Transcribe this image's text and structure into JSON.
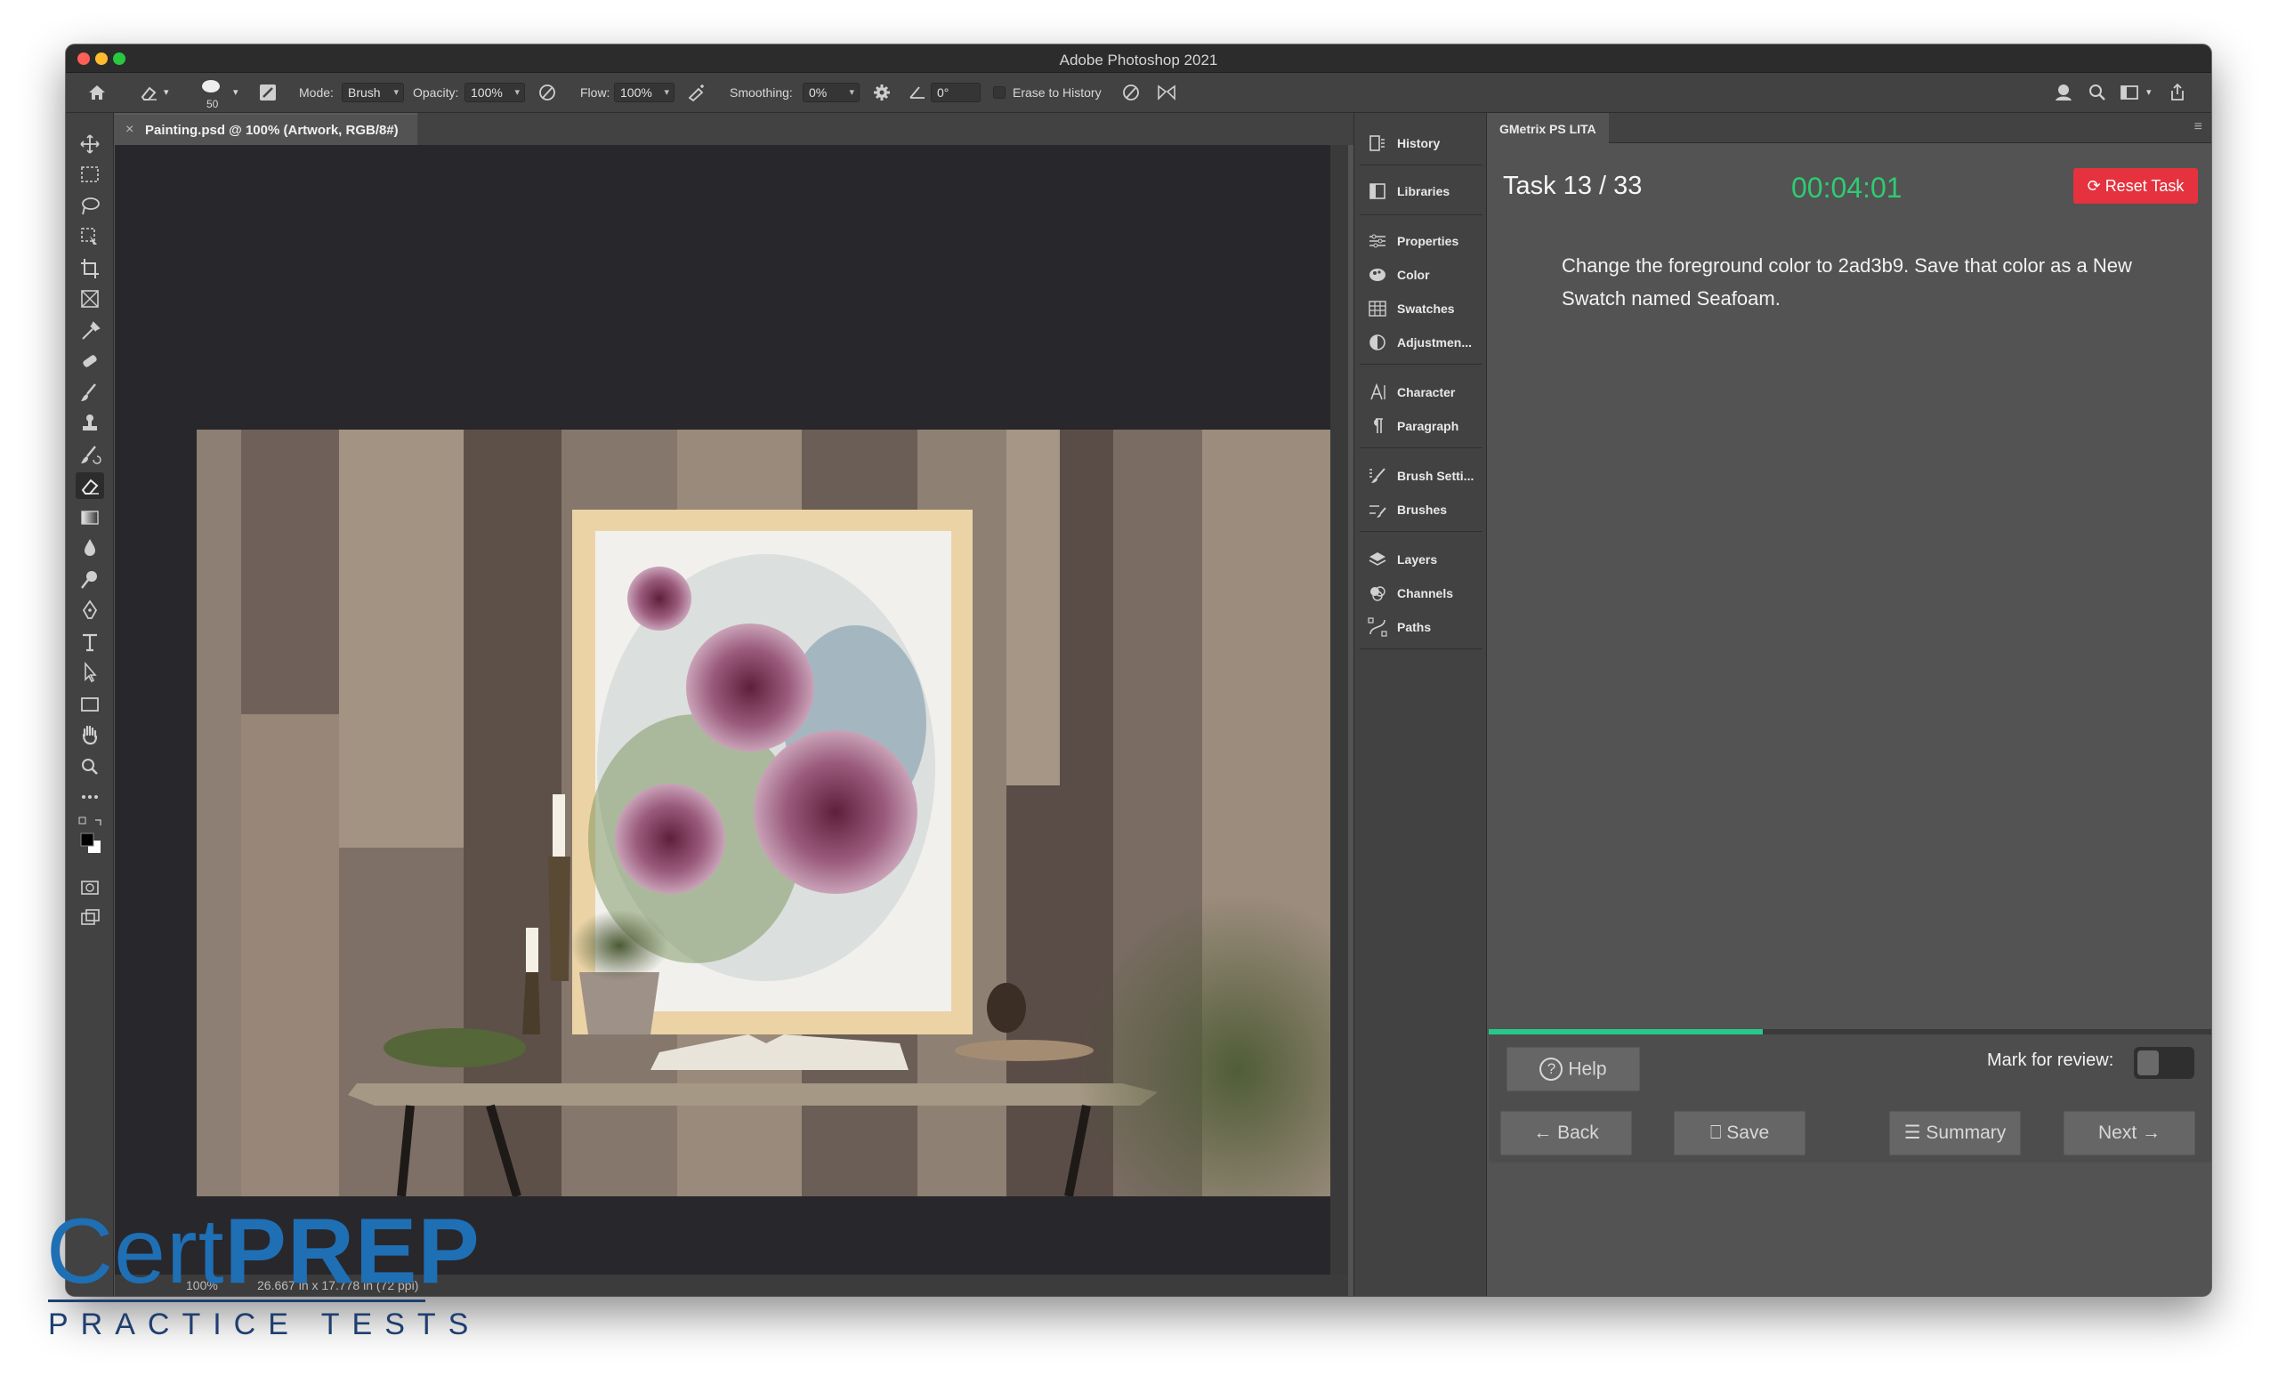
{
  "window": {
    "title": "Adobe Photoshop 2021"
  },
  "options_bar": {
    "brush_size": "50",
    "mode_label": "Mode:",
    "mode_value": "Brush",
    "opacity_label": "Opacity:",
    "opacity_value": "100%",
    "flow_label": "Flow:",
    "flow_value": "100%",
    "smoothing_label": "Smoothing:",
    "smoothing_value": "0%",
    "angle_value": "0°",
    "erase_history_label": "Erase to History"
  },
  "document": {
    "tab_title": "Painting.psd @ 100% (Artwork, RGB/8#)",
    "status_zoom": "100%",
    "status_dims": "26.667 in x 17.778 in (72 ppi)"
  },
  "dock": {
    "items": [
      {
        "label": "History",
        "icon": "history-icon"
      },
      {
        "label": "Libraries",
        "icon": "libraries-icon"
      },
      {
        "label": "Properties",
        "icon": "properties-icon"
      },
      {
        "label": "Color",
        "icon": "color-icon"
      },
      {
        "label": "Swatches",
        "icon": "swatches-icon"
      },
      {
        "label": "Adjustmen...",
        "icon": "adjustments-icon"
      },
      {
        "label": "Character",
        "icon": "character-icon"
      },
      {
        "label": "Paragraph",
        "icon": "paragraph-icon"
      },
      {
        "label": "Brush Setti...",
        "icon": "brush-settings-icon"
      },
      {
        "label": "Brushes",
        "icon": "brushes-icon"
      },
      {
        "label": "Layers",
        "icon": "layers-icon"
      },
      {
        "label": "Channels",
        "icon": "channels-icon"
      },
      {
        "label": "Paths",
        "icon": "paths-icon"
      }
    ]
  },
  "gmetrix": {
    "tab_label": "GMetrix PS LITA",
    "task_label": "Task 13 / 33",
    "timer": "00:04:01",
    "reset_label": "Reset Task",
    "instruction": "Change the foreground color to 2ad3b9. Save that color as a New Swatch named Seafoam.",
    "progress_fraction": 0.379,
    "help_label": "Help",
    "mark_review_label": "Mark for review:",
    "back_label": "Back",
    "save_label": "Save",
    "summary_label": "Summary",
    "next_label": "Next",
    "colors": {
      "timer": "#2ecc71",
      "reset": "#e5323e",
      "progress": "#27c98a"
    }
  },
  "watermark": {
    "cert": "Cert",
    "prep": "PREP",
    "subtitle": "PRACTICE TESTS"
  }
}
